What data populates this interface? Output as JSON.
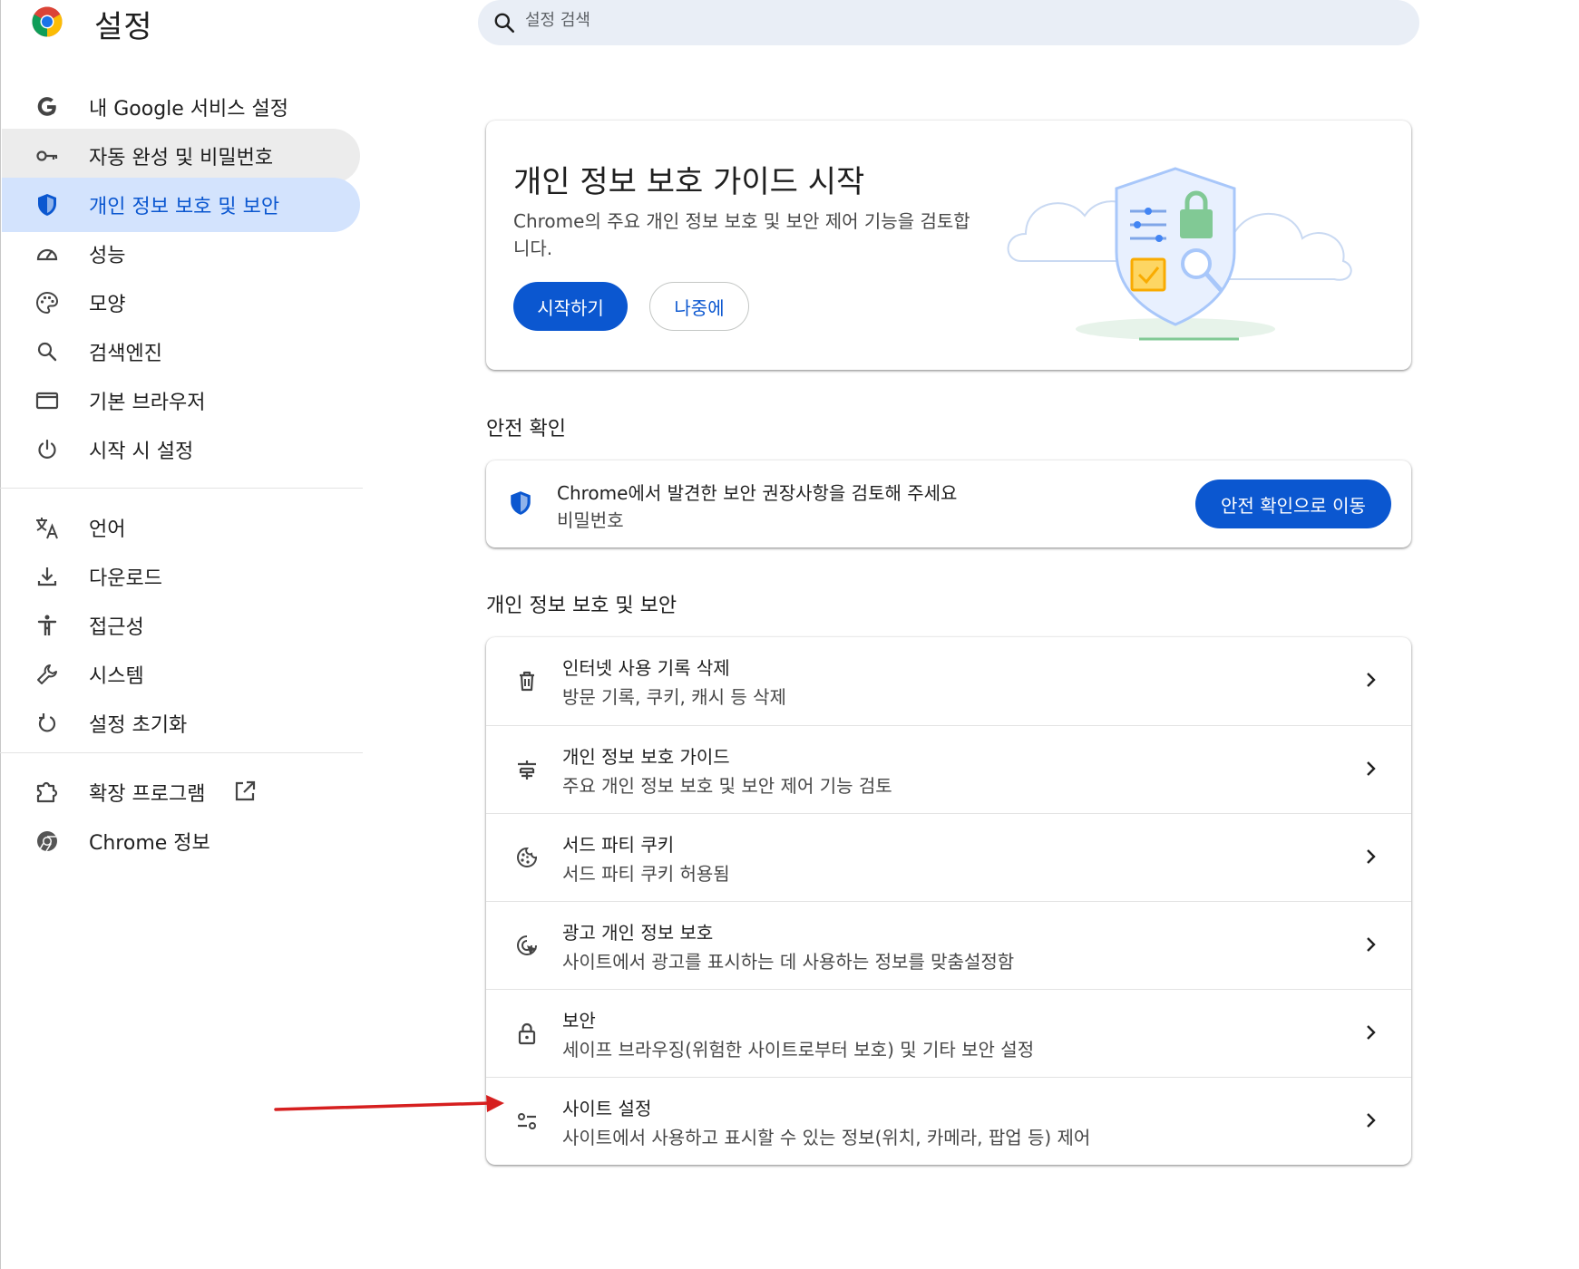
{
  "header": {
    "title": "설정",
    "search_placeholder": "설정 검색"
  },
  "sidebar": {
    "items": [
      {
        "label": "내 Google 서비스 설정",
        "icon": "google-g-icon"
      },
      {
        "label": "자동 완성 및 비밀번호",
        "icon": "key-icon"
      },
      {
        "label": "개인 정보 보호 및 보안",
        "icon": "shield-icon"
      },
      {
        "label": "성능",
        "icon": "speedometer-icon"
      },
      {
        "label": "모양",
        "icon": "palette-icon"
      },
      {
        "label": "검색엔진",
        "icon": "search-icon"
      },
      {
        "label": "기본 브라우저",
        "icon": "browser-window-icon"
      },
      {
        "label": "시작 시 설정",
        "icon": "power-icon"
      },
      {
        "label": "언어",
        "icon": "translate-icon"
      },
      {
        "label": "다운로드",
        "icon": "download-icon"
      },
      {
        "label": "접근성",
        "icon": "accessibility-icon"
      },
      {
        "label": "시스템",
        "icon": "wrench-icon"
      },
      {
        "label": "설정 초기화",
        "icon": "reset-icon"
      },
      {
        "label": "확장 프로그램",
        "icon": "puzzle-icon"
      },
      {
        "label": "Chrome 정보",
        "icon": "chrome-icon"
      }
    ],
    "active_index": 2,
    "hover_index": 1
  },
  "guide_card": {
    "title": "개인 정보 보호 가이드 시작",
    "description": "Chrome의 주요 개인 정보 보호 및 보안 제어 기능을 검토합니다.",
    "start_button": "시작하기",
    "later_button": "나중에"
  },
  "safety_check": {
    "heading": "안전 확인",
    "title": "Chrome에서 발견한 보안 권장사항을 검토해 주세요",
    "subtitle": "비밀번호",
    "button": "안전 확인으로 이동"
  },
  "privacy_section": {
    "heading": "개인 정보 보호 및 보안",
    "rows": [
      {
        "title": "인터넷 사용 기록 삭제",
        "subtitle": "방문 기록, 쿠키, 캐시 등 삭제",
        "icon": "trash-icon"
      },
      {
        "title": "개인 정보 보호 가이드",
        "subtitle": "주요 개인 정보 보호 및 보안 제어 기능 검토",
        "icon": "privacy-guide-icon"
      },
      {
        "title": "서드 파티 쿠키",
        "subtitle": "서드 파티 쿠키 허용됨",
        "icon": "cookie-icon"
      },
      {
        "title": "광고 개인 정보 보호",
        "subtitle": "사이트에서 광고를 표시하는 데 사용하는 정보를 맞춤설정함",
        "icon": "ad-privacy-icon"
      },
      {
        "title": "보안",
        "subtitle": "세이프 브라우징(위험한 사이트로부터 보호) 및 기타 보안 설정",
        "icon": "lock-icon"
      },
      {
        "title": "사이트 설정",
        "subtitle": "사이트에서 사용하고 표시할 수 있는 정보(위치, 카메라, 팝업 등) 제어",
        "icon": "site-settings-icon"
      }
    ]
  },
  "colors": {
    "accent": "#0b57d0",
    "active_nav_bg": "#d3e3fd",
    "hover_nav_bg": "#ececec",
    "annotation_arrow": "#d61f1f"
  }
}
